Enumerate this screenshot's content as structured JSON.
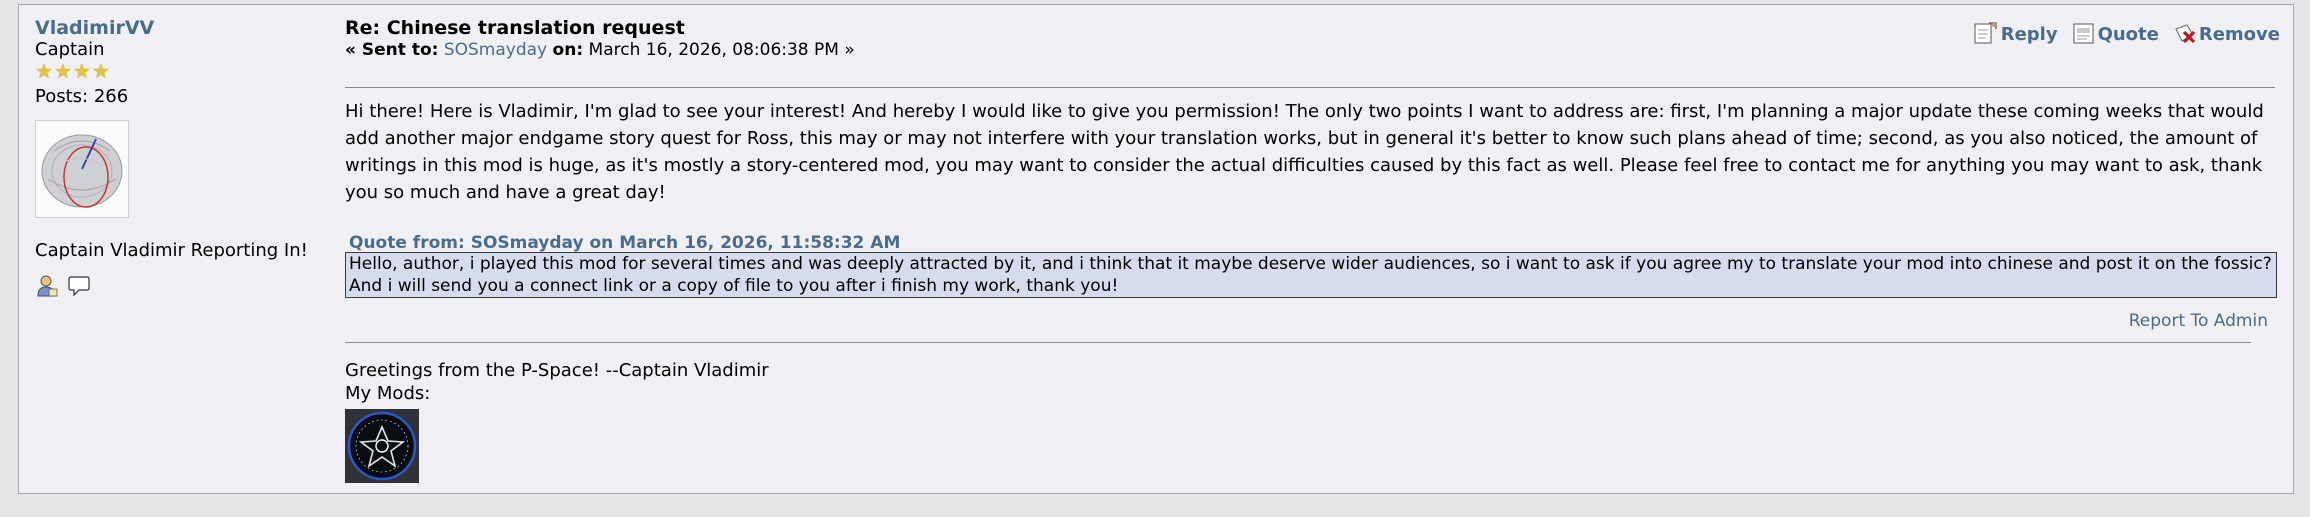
{
  "poster": {
    "name": "VladimirVV",
    "rank": "Captain",
    "stars": 4,
    "posts": "Posts: 266",
    "personal_text": "Captain Vladimir Reporting In!",
    "icons": [
      "profile-icon",
      "pm-icon"
    ]
  },
  "post": {
    "subject": "Re: Chinese translation request",
    "sent_prefix": "« Sent to:",
    "recipient": "SOSmayday",
    "on_label": "on:",
    "date": "March 16, 2026, 08:06:38 PM »",
    "body": "Hi there! Here is Vladimir, I'm glad to see your interest! And hereby I would like to give you permission! The only two points I want to address are: first, I'm planning a major update these coming weeks that would add another major endgame story quest for Ross, this may or may not interfere with your translation works, but in general it's better to know such plans ahead of time; second, as you also noticed, the amount of writings in this mod is huge, as it's mostly a story-centered mod, you may want to consider the actual difficulties caused by this fact as well. Please feel free to contact me for anything you may want to ask, thank you so much and have a great day!",
    "quote_header": "Quote from: SOSmayday on March 16, 2026, 11:58:32 AM",
    "quote_text": "Hello, author, i played this mod for several times and was deeply attracted by it, and i think that it maybe deserve wider audiences, so i want to ask if you agree my to translate your mod into chinese and post it on the fossic? And i will send you a connect link or a copy of file to you after i finish my work, thank you!",
    "report_link": "Report To Admin"
  },
  "actions": {
    "reply": "Reply",
    "quote": "Quote",
    "remove": "Remove"
  },
  "signature": {
    "line1": "Greetings from the P-Space! --Captain Vladimir",
    "line2": "My Mods:"
  },
  "colors": {
    "link": "#476c8e",
    "quote_bg": "#d6dbed",
    "post_bg": "#f0f0f4",
    "page_bg": "#e5e5e8"
  }
}
